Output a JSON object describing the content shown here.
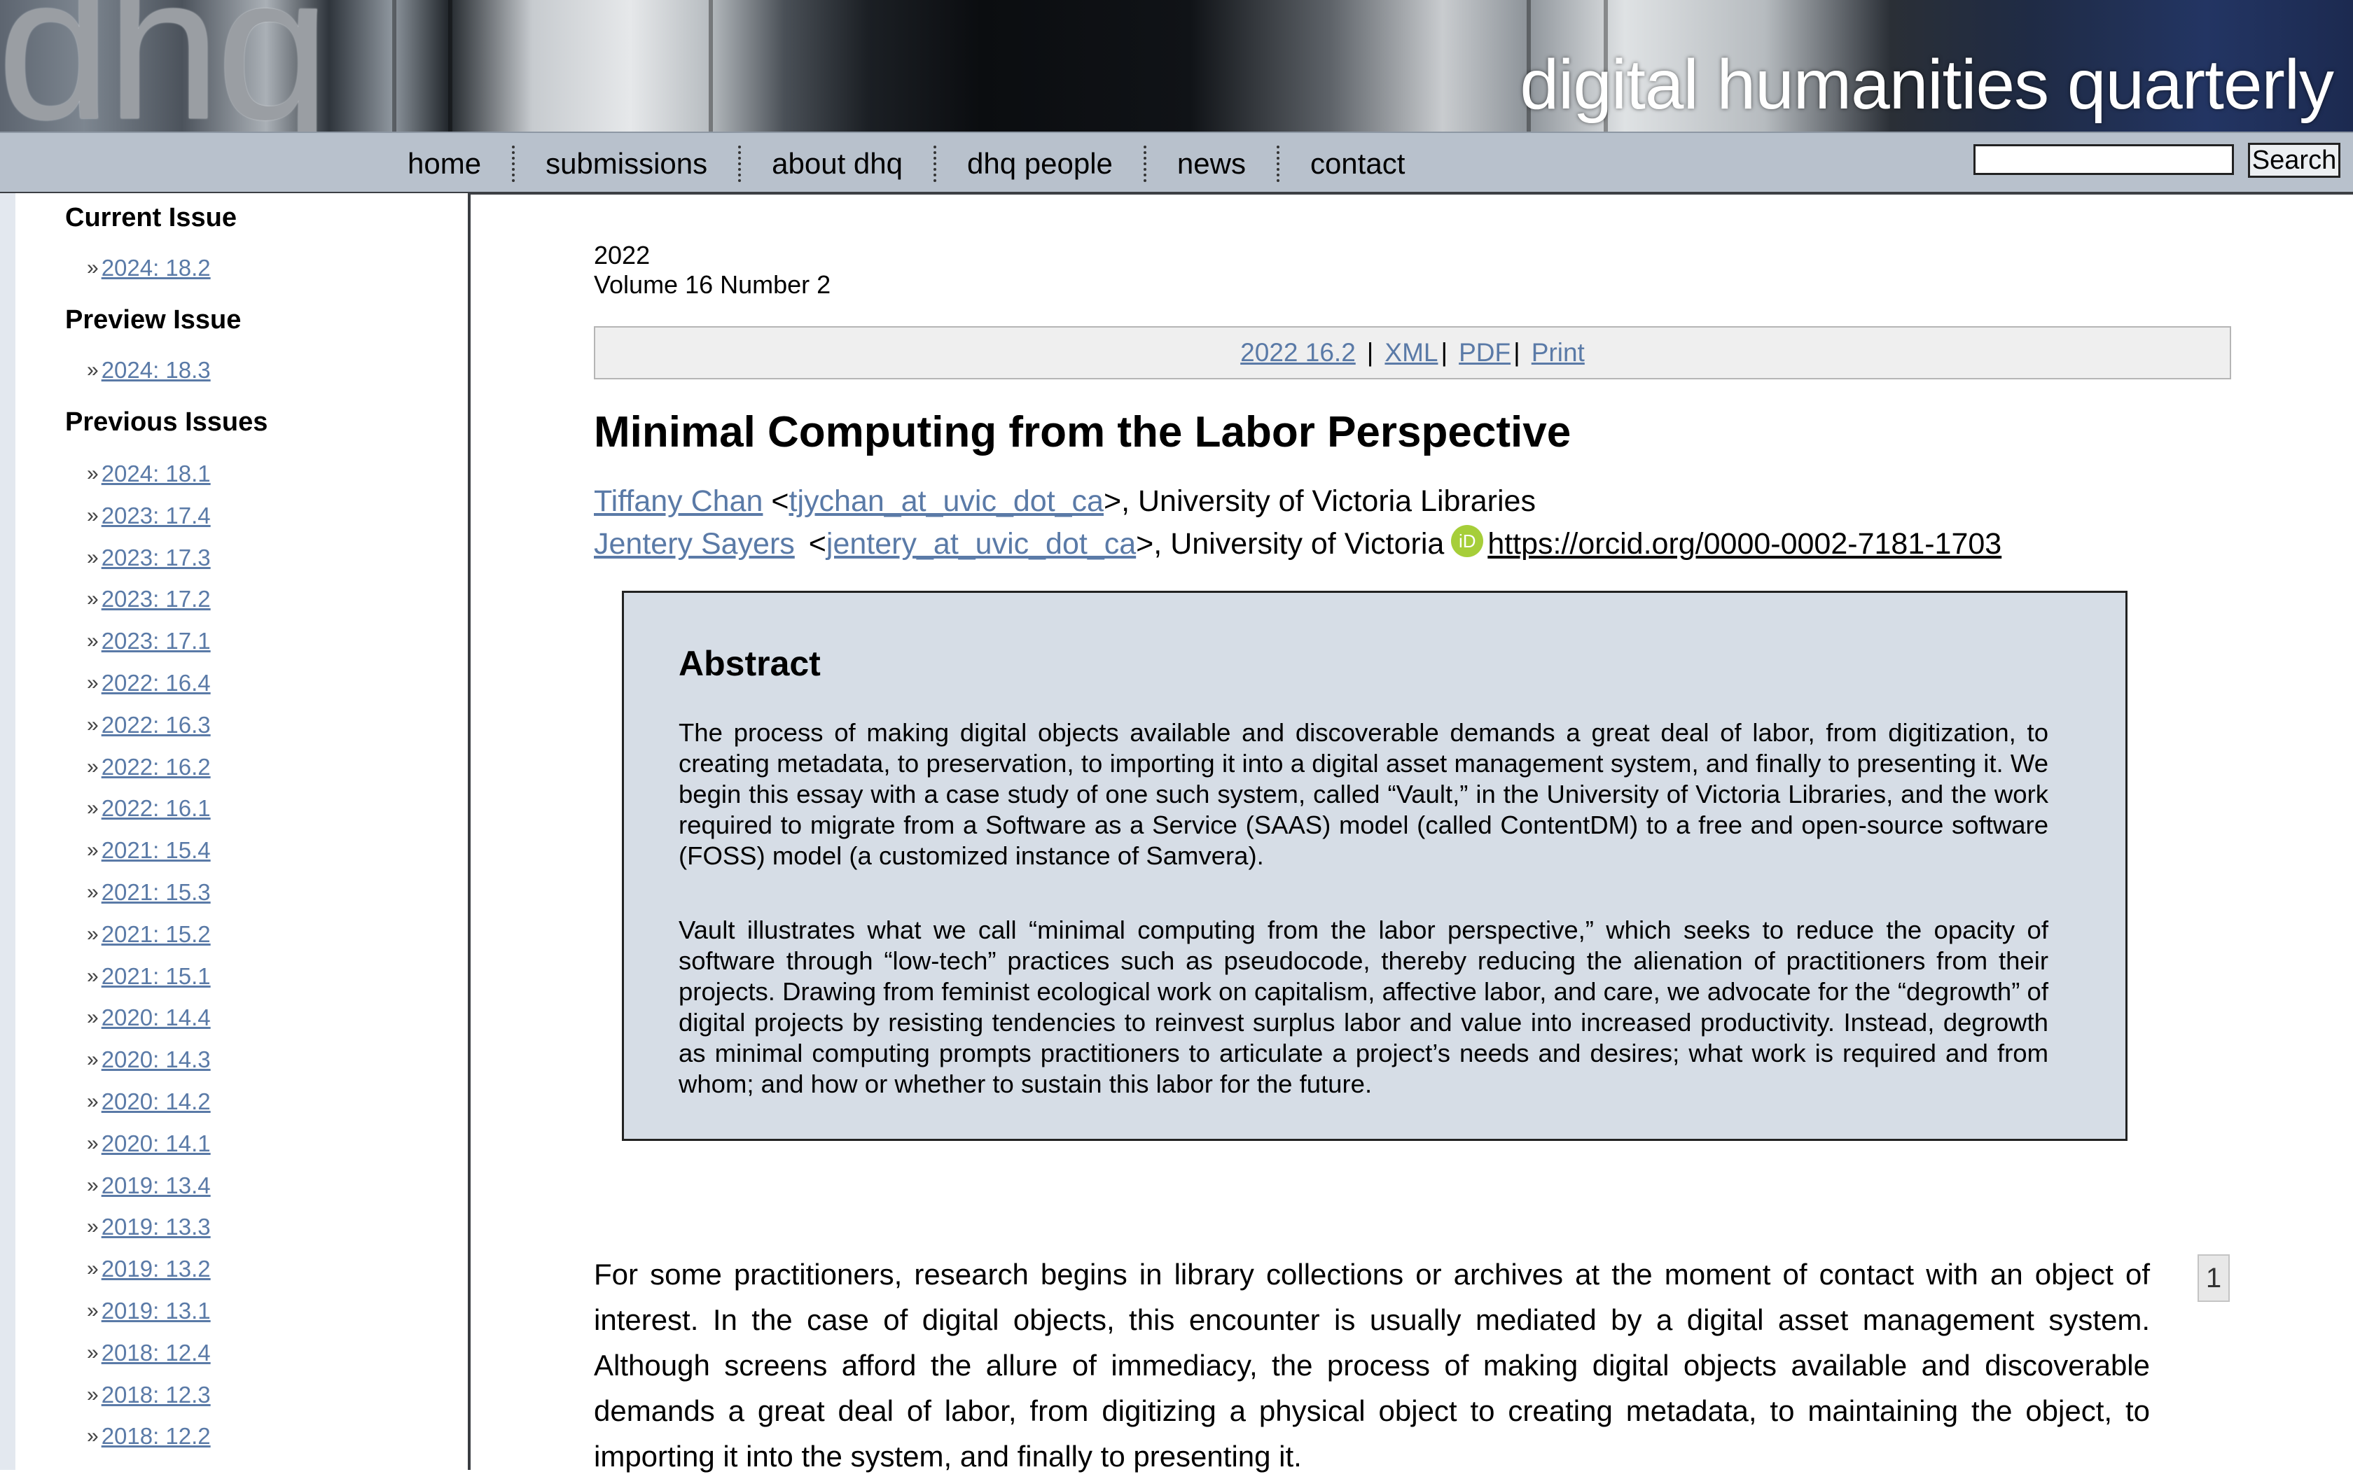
{
  "header": {
    "logo": "dhq",
    "site_title": "digital humanities quarterly"
  },
  "nav": {
    "items": [
      "home",
      "submissions",
      "about dhq",
      "dhq people",
      "news",
      "contact"
    ],
    "search_value": "",
    "search_button": "Search"
  },
  "sidebar": {
    "current_heading": "Current Issue",
    "current_issue": "2024: 18.2",
    "preview_heading": "Preview Issue",
    "preview_issue": "2024: 18.3",
    "previous_heading": "Previous Issues",
    "bullet": "»",
    "previous_issues": [
      "2024: 18.1",
      "2023: 17.4",
      "2023: 17.3",
      "2023: 17.2",
      "2023: 17.1",
      "2022: 16.4",
      "2022: 16.3",
      "2022: 16.2",
      "2022: 16.1",
      "2021: 15.4",
      "2021: 15.3",
      "2021: 15.2",
      "2021: 15.1",
      "2020: 14.4",
      "2020: 14.3",
      "2020: 14.2",
      "2020: 14.1",
      "2019: 13.4",
      "2019: 13.3",
      "2019: 13.2",
      "2019: 13.1",
      "2018: 12.4",
      "2018: 12.3",
      "2018: 12.2"
    ]
  },
  "article": {
    "year": "2022",
    "volume": "Volume 16 Number 2",
    "toolbar": {
      "issue_link": "2022 16.2",
      "xml": "XML",
      "pdf": "PDF",
      "print": "Print"
    },
    "title": "Minimal Computing from the Labor Perspective",
    "authors": [
      {
        "name": "Tiffany Chan",
        "email": "tjychan_at_uvic_dot_ca",
        "affiliation": "University of Victoria Libraries"
      },
      {
        "name": "Jentery Sayers",
        "email": "jentery_at_uvic_dot_ca",
        "affiliation": "University of Victoria",
        "orcid_icon_text": "iD",
        "orcid": "https://orcid.org/0000-0002-7181-1703"
      }
    ],
    "abstract": {
      "heading": "Abstract",
      "paragraphs": [
        "The process of making digital objects available and discoverable demands a great deal of labor, from digitization, to creating metadata, to preservation, to importing it into a digital asset management system, and finally to presenting it. We begin this essay with a case study of one such system, called “Vault,” in the University of Victoria Libraries, and the work required to migrate from a Software as a Service (SAAS) model (called ContentDM) to a free and open-source software (FOSS) model (a customized instance of Samvera).",
        "Vault illustrates what we call “minimal computing from the labor perspective,” which seeks to reduce the opacity of software through “low-tech” practices such as pseudocode, thereby reducing the alienation of practitioners from their projects. Drawing from feminist ecological work on capitalism, affective labor, and care, we advocate for the “degrowth” of digital projects by resisting tendencies to reinvest surplus labor and value into increased productivity. Instead, degrowth as minimal computing prompts practitioners to articulate a project’s needs and desires; what work is required and from whom; and how or whether to sustain this labor for the future."
      ]
    },
    "body_paragraph": "For some practitioners, research begins in library collections or archives at the moment of contact with an object of interest. In the case of digital objects, this encounter is usually mediated by a digital asset management system. Although screens afford the allure of immediacy, the process of making digital objects available and discoverable demands a great deal of labor, from digitizing a physical object to creating metadata, to maintaining the object, to importing it into the system, and finally to presenting it.",
    "paragraph_number": "1"
  }
}
